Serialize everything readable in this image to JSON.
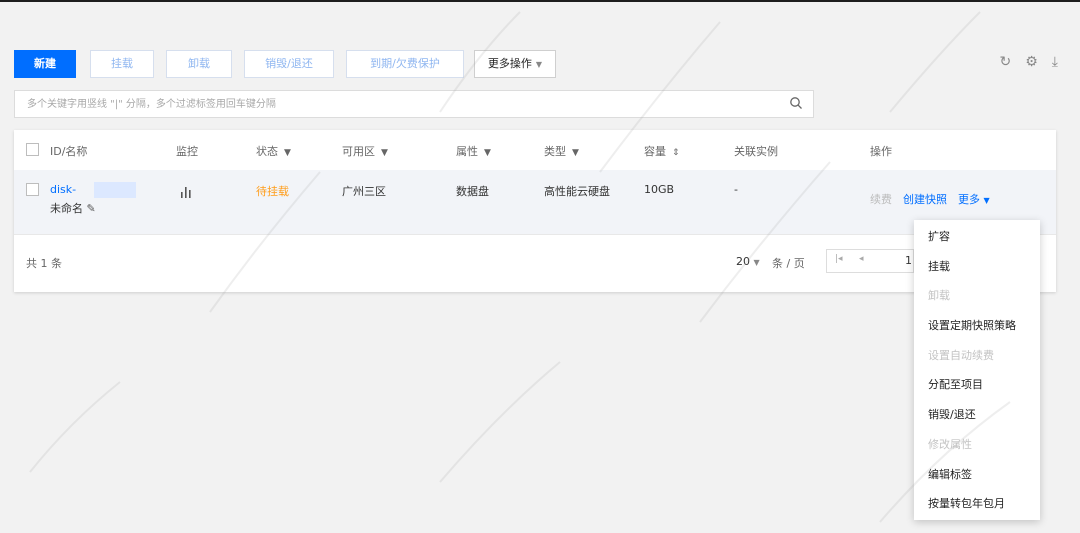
{
  "toolbar": {
    "new_label": "新建",
    "attach_label": "挂载",
    "detach_label": "卸载",
    "destroy_label": "销毁/退还",
    "expiry_protect_label": "到期/欠费保护",
    "more_ops_label": "更多操作"
  },
  "search": {
    "placeholder": "多个关键字用竖线 \"|\" 分隔，多个过滤标签用回车键分隔"
  },
  "table": {
    "headers": {
      "id_name": "ID/名称",
      "monitor": "监控",
      "status": "状态",
      "zone": "可用区",
      "attribute": "属性",
      "type": "类型",
      "capacity": "容量",
      "linked_instance": "关联实例",
      "actions": "操作"
    },
    "rows": [
      {
        "id": "disk-",
        "name": "未命名",
        "status": "待挂载",
        "zone": "广州三区",
        "attribute": "数据盘",
        "type": "高性能云硬盘",
        "capacity": "10GB",
        "linked_instance": "-",
        "actions": {
          "renew": "续费",
          "create_snapshot": "创建快照",
          "more": "更多"
        }
      }
    ],
    "footer": {
      "total": "共 1 条",
      "page_size": "20",
      "per_page": "条 / 页",
      "page": "1"
    }
  },
  "more_menu": [
    {
      "label": "扩容",
      "disabled": false
    },
    {
      "label": "挂载",
      "disabled": false
    },
    {
      "label": "卸载",
      "disabled": true
    },
    {
      "label": "设置定期快照策略",
      "disabled": false
    },
    {
      "label": "设置自动续费",
      "disabled": true
    },
    {
      "label": "分配至项目",
      "disabled": false
    },
    {
      "label": "销毁/退还",
      "disabled": false
    },
    {
      "label": "修改属性",
      "disabled": true
    },
    {
      "label": "编辑标签",
      "disabled": false
    },
    {
      "label": "按量转包年包月",
      "disabled": false
    }
  ],
  "colors": {
    "primary": "#006eff",
    "warning": "#ff9c19",
    "disabled": "#bbbbbb"
  }
}
